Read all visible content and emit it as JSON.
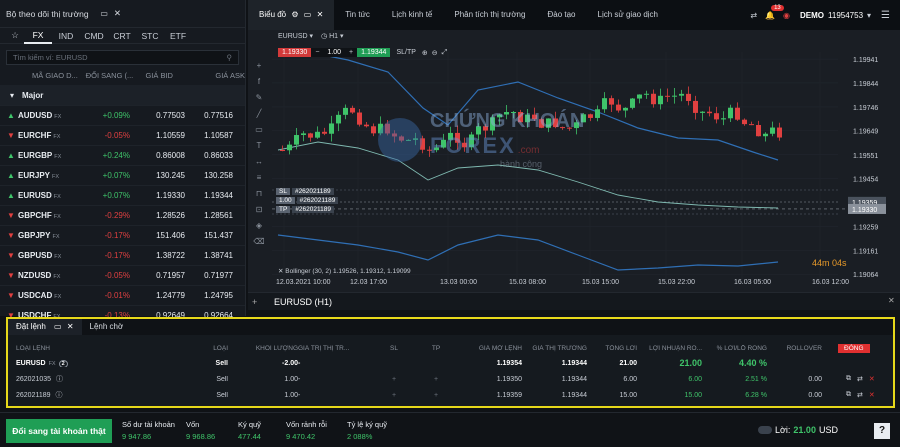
{
  "watchlist": {
    "title": "Bộ theo dõi thị trường",
    "tabs": [
      "FX",
      "IND",
      "CMD",
      "CRT",
      "STC",
      "ETF"
    ],
    "active_tab": "FX",
    "search_placeholder": "Tìm kiếm ví: EURUSD",
    "columns": [
      "MÃ GIAO D...",
      "ĐỔI SANG (...",
      "GIÁ BID",
      "GIÁ ASK"
    ],
    "group": "Major",
    "rows": [
      {
        "symbol": "AUDUSD",
        "tag": "FX",
        "change": "+0.09%",
        "dir": "up",
        "bid": "0.77503",
        "ask": "0.77516"
      },
      {
        "symbol": "EURCHF",
        "tag": "FX",
        "change": "-0.05%",
        "dir": "down",
        "bid": "1.10559",
        "ask": "1.10587"
      },
      {
        "symbol": "EURGBP",
        "tag": "FX",
        "change": "+0.24%",
        "dir": "up",
        "bid": "0.86008",
        "ask": "0.86033"
      },
      {
        "symbol": "EURJPY",
        "tag": "FX",
        "change": "+0.07%",
        "dir": "up",
        "bid": "130.245",
        "ask": "130.258"
      },
      {
        "symbol": "EURUSD",
        "tag": "FX",
        "change": "+0.07%",
        "dir": "up",
        "bid": "1.19330",
        "ask": "1.19344"
      },
      {
        "symbol": "GBPCHF",
        "tag": "FX",
        "change": "-0.29%",
        "dir": "down",
        "bid": "1.28526",
        "ask": "1.28561"
      },
      {
        "symbol": "GBPJPY",
        "tag": "FX",
        "change": "-0.17%",
        "dir": "down",
        "bid": "151.406",
        "ask": "151.437"
      },
      {
        "symbol": "GBPUSD",
        "tag": "FX",
        "change": "-0.17%",
        "dir": "down",
        "bid": "1.38722",
        "ask": "1.38741"
      },
      {
        "symbol": "NZDUSD",
        "tag": "FX",
        "change": "-0.05%",
        "dir": "down",
        "bid": "0.71957",
        "ask": "0.71977"
      },
      {
        "symbol": "USDCAD",
        "tag": "FX",
        "change": "-0.01%",
        "dir": "down",
        "bid": "1.24779",
        "ask": "1.24795"
      },
      {
        "symbol": "USDCHF",
        "tag": "FX",
        "change": "-0.13%",
        "dir": "down",
        "bid": "0.92649",
        "ask": "0.92664"
      }
    ]
  },
  "topbar": {
    "tabs": [
      "Biểu đồ",
      "Tin tức",
      "Lịch kinh tế",
      "Phân tích thị trường",
      "Đào tạo",
      "Lịch sử giao dịch"
    ],
    "notification_count": "13",
    "account": "DEMO",
    "account_id": "11954753"
  },
  "chart": {
    "symbol_label": "EURUSD (H1)",
    "sell_price": "1.19330",
    "buy_price": "1.19344",
    "lot": "1.00",
    "timeframe": "H1",
    "sltp": "SL/TP",
    "indicator": "Bollinger (30, 2) 1.19526, 1.19312, 1.19099",
    "countdown": "44m 04s",
    "sl_label": "SL",
    "tp_label": "TP",
    "order_ref": "#262021189",
    "y_ticks": [
      "1.19941",
      "1.19844",
      "1.19746",
      "1.19649",
      "1.19551",
      "1.19454",
      "1.19359",
      "1.19330",
      "1.19259",
      "1.19161",
      "1.19064"
    ],
    "x_ticks": [
      "12.03.2021 10:00",
      "12.03 17:00",
      "13.03 00:00",
      "15.03 08:00",
      "15.03 15:00",
      "15.03 22:00",
      "16.03 05:00",
      "16.03 12:00"
    ],
    "watermark_title": "CHỨNG KHOÁN",
    "watermark_sub": "FOREX",
    "watermark_tag": "hành công",
    "watermark_com": ".com"
  },
  "orders": {
    "tabs": [
      "Đặt lệnh",
      "Lệnh chờ"
    ],
    "columns": [
      "LOẠI LỆNH",
      "LOẠI",
      "KHỐI LƯỢNG",
      "GIÁ TRỊ THỊ TR...",
      "SL",
      "TP",
      "GIÁ MỞ LỆNH",
      "GIÁ THỊ TRƯỜNG",
      "TỔNG LỜI",
      "LỢI NHUẬN RÒ...",
      "% LỜI/LỖ RÒNG",
      "ROLLOVER"
    ],
    "close_button": "ĐÓNG",
    "summary": {
      "symbol": "EURUSD",
      "tag": "FX",
      "count": "2",
      "type": "Sell",
      "volume": "-2.00",
      "market_value": "-",
      "open": "1.19354",
      "market": "1.19344",
      "gross": "21.00",
      "net": "21.00",
      "pct": "4.40 %"
    },
    "rows": [
      {
        "id": "262021035",
        "type": "Sell",
        "volume": "1.00",
        "market_value": "-",
        "sl": "+",
        "tp": "+",
        "open": "1.19350",
        "market": "1.19344",
        "gross": "6.00",
        "net": "6.00",
        "pct": "2.51 %",
        "rollover": "0.00"
      },
      {
        "id": "262021189",
        "type": "Sell",
        "volume": "1.00",
        "market_value": "-",
        "sl": "+",
        "tp": "+",
        "open": "1.19359",
        "market": "1.19344",
        "gross": "15.00",
        "net": "15.00",
        "pct": "6.28 %",
        "rollover": "0.00"
      }
    ]
  },
  "footer": {
    "real_account_button": "Đổi sang tài khoản thật",
    "stats": [
      {
        "label": "Số dư tài khoản",
        "value": "9 947.86"
      },
      {
        "label": "Vốn",
        "value": "9 968.86"
      },
      {
        "label": "Ký quỹ",
        "value": "477.44"
      },
      {
        "label": "Vốn rảnh rỗi",
        "value": "9 470.42"
      },
      {
        "label": "Tỷ lệ ký quỹ",
        "value": "2 088%"
      }
    ],
    "profit_label": "Lời:",
    "profit_value": "21.00",
    "currency": "USD",
    "help": "?"
  },
  "colors": {
    "up": "#3fc46a",
    "down": "#e04040",
    "accent_yellow": "#e6d81a",
    "bb_band": "#2f6fb5",
    "bb_mid": "#7fb9b0"
  }
}
